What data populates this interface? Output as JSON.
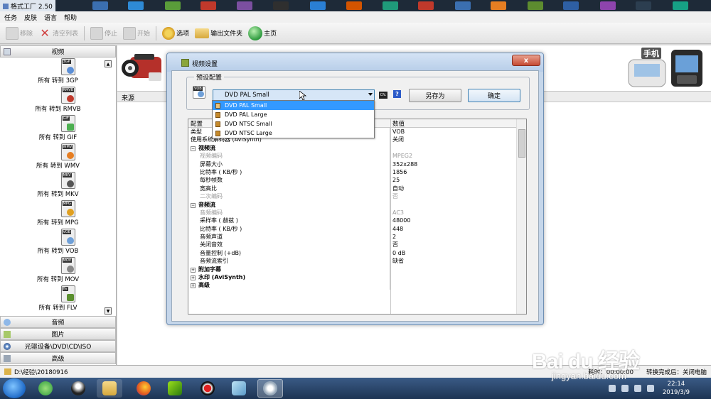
{
  "app": {
    "title": "格式工厂 2.50"
  },
  "menu": [
    "任务",
    "皮肤",
    "语言",
    "帮助"
  ],
  "toolbar": {
    "remove": "移除",
    "clear": "清空列表",
    "stop": "停止",
    "start": "开始",
    "options": "选项",
    "output_folder": "输出文件夹",
    "home": "主页"
  },
  "sidebar": {
    "video": "视频",
    "audio": "音频",
    "picture": "图片",
    "optical": "光驱设备\\DVD\\CD\\ISO",
    "advanced": "高级",
    "conversions": [
      {
        "badge": "3GP",
        "label": "所有 转到 3GP"
      },
      {
        "badge": "RMVB",
        "label": "所有 转到 RMVB"
      },
      {
        "badge": "GIF",
        "label": "所有 转到 GIF"
      },
      {
        "badge": "WMV",
        "label": "所有 转到 WMV"
      },
      {
        "badge": "MKV",
        "label": "所有 转到 MKV"
      },
      {
        "badge": "MPG",
        "label": "所有 转到 MPG"
      },
      {
        "badge": "VOB",
        "label": "所有 转到 VOB"
      },
      {
        "badge": "MOV",
        "label": "所有 转到 MOV"
      },
      {
        "badge": "flv",
        "label": "所有 转到 FLV"
      }
    ]
  },
  "main": {
    "source_header": "来源",
    "phone_label": "手机"
  },
  "dialog": {
    "title": "视频设置",
    "preset_legend": "预设配置",
    "selected": "DVD PAL Small",
    "options": [
      "DVD PAL Small",
      "DVD PAL Large",
      "DVD NTSC Small",
      "DVD NTSC Large"
    ],
    "small_icon_label": "CN.",
    "help": "?",
    "save_as": "另存为",
    "ok": "确定",
    "close": "x",
    "col_config": "配置",
    "col_value": "数值",
    "rows": [
      {
        "k": "类型",
        "v": "VOB",
        "style": "plain"
      },
      {
        "k": "使用系统解码器 (AviSynth)",
        "v": "关闭",
        "style": "plain"
      },
      {
        "k": "视频流",
        "v": "",
        "style": "group",
        "toggle": "−"
      },
      {
        "k": "视频编码",
        "v": "MPEG2",
        "style": "dim"
      },
      {
        "k": "屏幕大小",
        "v": "352x288",
        "style": "sub"
      },
      {
        "k": "比特率 ( KB/秒 )",
        "v": "1856",
        "style": "sub"
      },
      {
        "k": "每秒帧数",
        "v": "25",
        "style": "sub"
      },
      {
        "k": "宽高比",
        "v": "自动",
        "style": "sub"
      },
      {
        "k": "二次编码",
        "v": "否",
        "style": "dim"
      },
      {
        "k": "音频流",
        "v": "",
        "style": "group",
        "toggle": "−"
      },
      {
        "k": "音频编码",
        "v": "AC3",
        "style": "dim"
      },
      {
        "k": "采样率 ( 赫兹 )",
        "v": "48000",
        "style": "sub"
      },
      {
        "k": "比特率 ( KB/秒 )",
        "v": "448",
        "style": "sub"
      },
      {
        "k": "音频声道",
        "v": "2",
        "style": "sub"
      },
      {
        "k": "关闭音效",
        "v": "否",
        "style": "sub"
      },
      {
        "k": "音量控制 (+dB)",
        "v": "0 dB",
        "style": "sub"
      },
      {
        "k": "音频流索引",
        "v": "缺省",
        "style": "sub"
      },
      {
        "k": "附加字幕",
        "v": "",
        "style": "group",
        "toggle": "+"
      },
      {
        "k": "水印 (AviSynth)",
        "v": "",
        "style": "group",
        "toggle": "+"
      },
      {
        "k": "高级",
        "v": "",
        "style": "group",
        "toggle": "+"
      }
    ]
  },
  "statusbar": {
    "path": "D:\\经验\\20180916",
    "elapsed": "耗时：00:00:00",
    "after": "转换完成后：关闭电脑"
  },
  "taskbar": {
    "time": "22:14",
    "date": "2019/3/9"
  },
  "watermark": {
    "brand": "Bai du 经验",
    "url": "jingyan.baidu.com"
  },
  "colors": {
    "accent": "#3399ff",
    "dialog_frame": "#c5d6ea",
    "taskbar": "#1d3453",
    "close": "#c64a33"
  }
}
